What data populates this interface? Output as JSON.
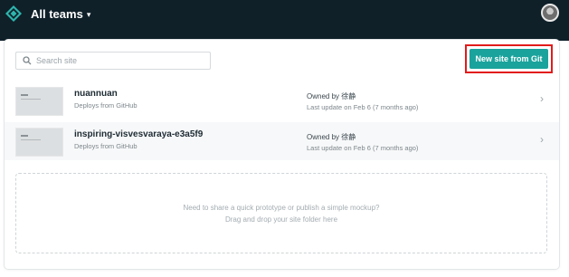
{
  "header": {
    "team_label": "All teams",
    "chevron": "▾",
    "logo_icon": "netlify-logo-icon",
    "avatar_icon": "user-avatar"
  },
  "toolbar": {
    "search_placeholder": "Search site",
    "new_site_label": "New site from Git"
  },
  "sites": [
    {
      "name": "nuannuan",
      "deploy_source": "Deploys from GitHub",
      "owner": "Owned by 徐静",
      "last_update": "Last update on Feb 6 (7 months ago)"
    },
    {
      "name": "inspiring-visvesvaraya-e3a5f9",
      "deploy_source": "Deploys from GitHub",
      "owner": "Owned by 徐静",
      "last_update": "Last update on Feb 6 (7 months ago)"
    }
  ],
  "row_chevron": "›",
  "dropzone": {
    "line1": "Need to share a quick prototype or publish a simple mockup?",
    "line2": "Drag and drop your site folder here"
  },
  "colors": {
    "header_bg": "#0f2029",
    "accent": "#1aa39c",
    "highlight": "#e21b1b"
  }
}
